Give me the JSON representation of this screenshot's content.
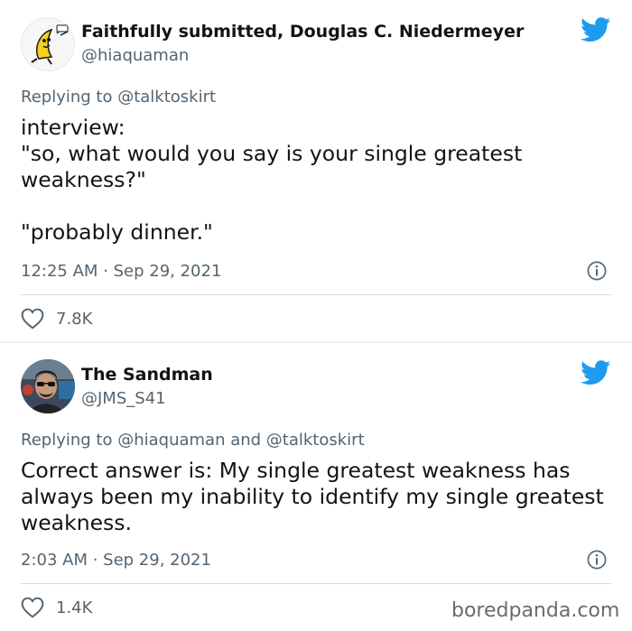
{
  "tweets": [
    {
      "display_name": "Faithfully submitted, Douglas C. Niedermeyer",
      "handle": "@hiaquaman",
      "replying_prefix": "Replying to ",
      "replying_to": [
        "@talktoskirt"
      ],
      "text_lines": [
        "interview:",
        "\"so, what would you say is your single greatest weakness?\"",
        "",
        "\"probably dinner.\""
      ],
      "timestamp": "12:25 AM · Sep 29, 2021",
      "likes": "7.8K",
      "avatar_icon": "banana-cartoon-avatar"
    },
    {
      "display_name": "The Sandman",
      "handle": "@JMS_S41",
      "replying_prefix": "Replying to ",
      "replying_to": [
        "@hiaquaman",
        "@talktoskirt"
      ],
      "replying_joiner": " and ",
      "text_lines": [
        "Correct answer is: My single greatest weakness has always been my inability to identify my single greatest weakness."
      ],
      "timestamp": "2:03 AM · Sep 29, 2021",
      "likes": "1.4K",
      "avatar_icon": "man-with-sunglasses-avatar"
    }
  ],
  "watermark": "boredpanda.com",
  "colors": {
    "twitter_blue": "#1d9bf0",
    "secondary_text": "#536471",
    "primary_text": "#0f1419",
    "divider": "#cfd9de"
  },
  "icons": [
    "twitter-bird-icon",
    "info-icon",
    "heart-icon"
  ]
}
